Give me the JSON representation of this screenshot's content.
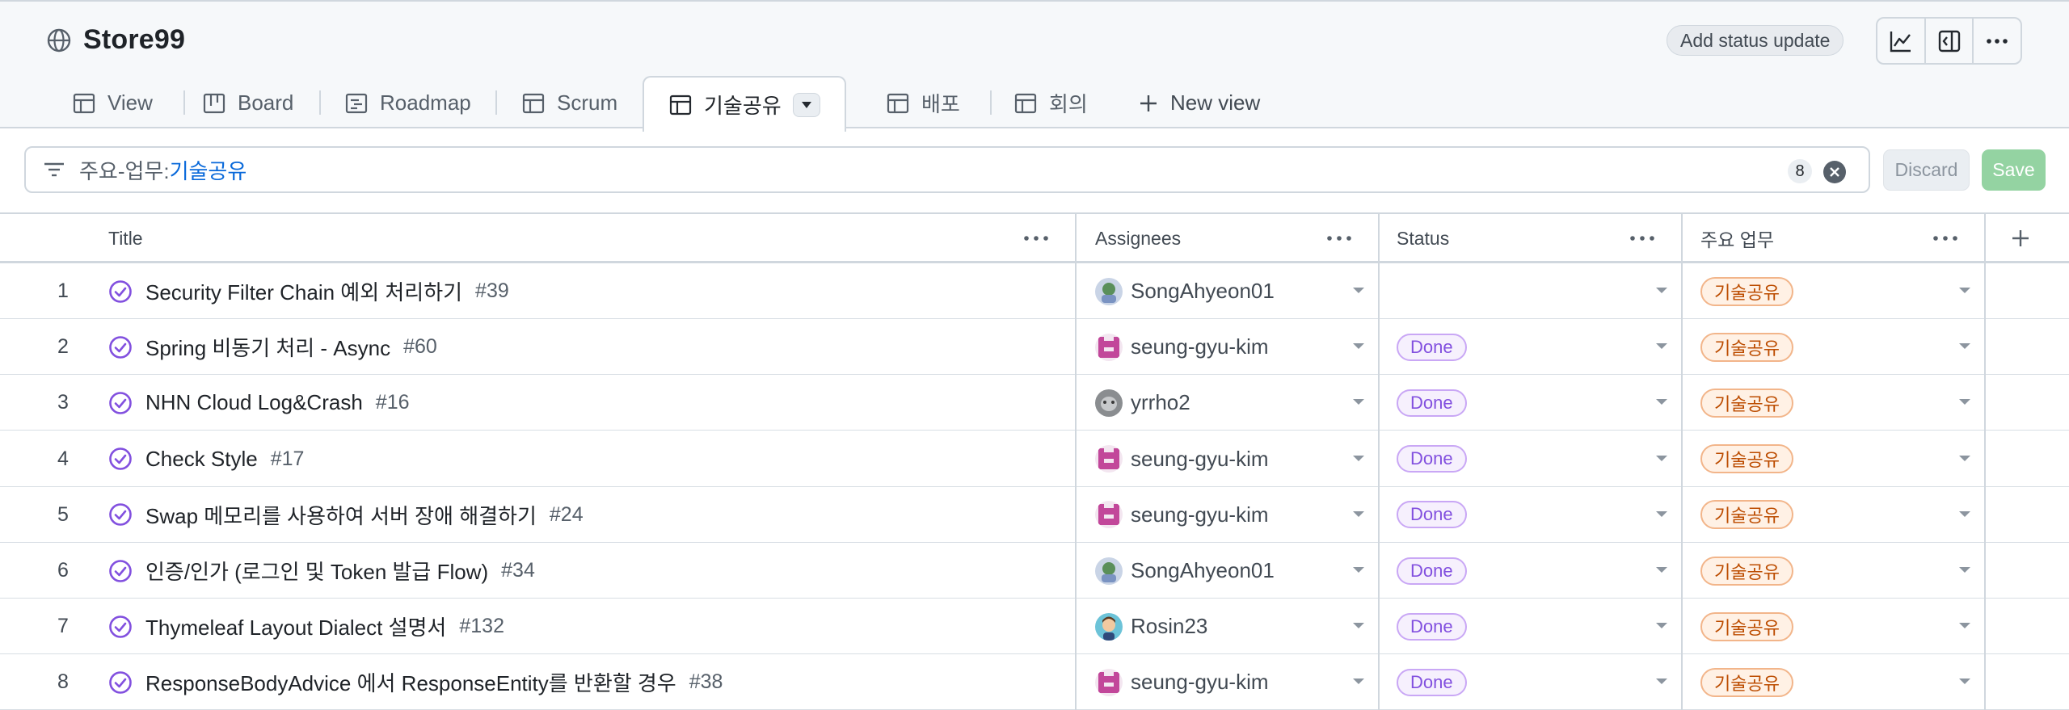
{
  "project": {
    "title": "Store99"
  },
  "header_actions": {
    "add_status_label": "Add status update"
  },
  "tabs": [
    {
      "label": "View",
      "icon": "table-icon"
    },
    {
      "label": "Board",
      "icon": "board-icon"
    },
    {
      "label": "Roadmap",
      "icon": "roadmap-icon"
    },
    {
      "label": "Scrum",
      "icon": "table-icon"
    },
    {
      "label": "기술공유",
      "icon": "table-icon",
      "active": true
    },
    {
      "label": "배포",
      "icon": "table-icon"
    },
    {
      "label": "회의",
      "icon": "table-icon"
    }
  ],
  "new_view_label": "New view",
  "filter": {
    "field": "주요-업무:",
    "value": "기술공유",
    "count": "8"
  },
  "actions": {
    "discard": "Discard",
    "save": "Save"
  },
  "columns": {
    "title": "Title",
    "assignees": "Assignees",
    "status": "Status",
    "main_work": "주요 업무"
  },
  "rows": [
    {
      "num": "1",
      "title": "Security Filter Chain 예외 처리하기",
      "issue": "#39",
      "assignee": "SongAhyeon01",
      "avatar": "song",
      "status": "",
      "tag": "기술공유"
    },
    {
      "num": "2",
      "title": "Spring 비동기 처리 - Async",
      "issue": "#60",
      "assignee": "seung-gyu-kim",
      "avatar": "pixel",
      "status": "Done",
      "tag": "기술공유"
    },
    {
      "num": "3",
      "title": "NHN Cloud Log&Crash",
      "issue": "#16",
      "assignee": "yrrho2",
      "avatar": "gray",
      "status": "Done",
      "tag": "기술공유"
    },
    {
      "num": "4",
      "title": "Check Style",
      "issue": "#17",
      "assignee": "seung-gyu-kim",
      "avatar": "pixel",
      "status": "Done",
      "tag": "기술공유"
    },
    {
      "num": "5",
      "title": "Swap 메모리를 사용하여 서버 장애 해결하기",
      "issue": "#24",
      "assignee": "seung-gyu-kim",
      "avatar": "pixel",
      "status": "Done",
      "tag": "기술공유"
    },
    {
      "num": "6",
      "title": "인증/인가 (로그인 및 Token 발급 Flow)",
      "issue": "#34",
      "assignee": "SongAhyeon01",
      "avatar": "song",
      "status": "Done",
      "tag": "기술공유"
    },
    {
      "num": "7",
      "title": "Thymeleaf Layout Dialect 설명서",
      "issue": "#132",
      "assignee": "Rosin23",
      "avatar": "rosin",
      "status": "Done",
      "tag": "기술공유"
    },
    {
      "num": "8",
      "title": "ResponseBodyAdvice 에서 ResponseEntity를 반환할 경우",
      "issue": "#38",
      "assignee": "seung-gyu-kim",
      "avatar": "pixel",
      "status": "Done",
      "tag": "기술공유"
    }
  ],
  "colors": {
    "accent": "#8250df",
    "tag_text": "#bc4c00",
    "save_bg": "#94d3a2",
    "link": "#0969da"
  }
}
